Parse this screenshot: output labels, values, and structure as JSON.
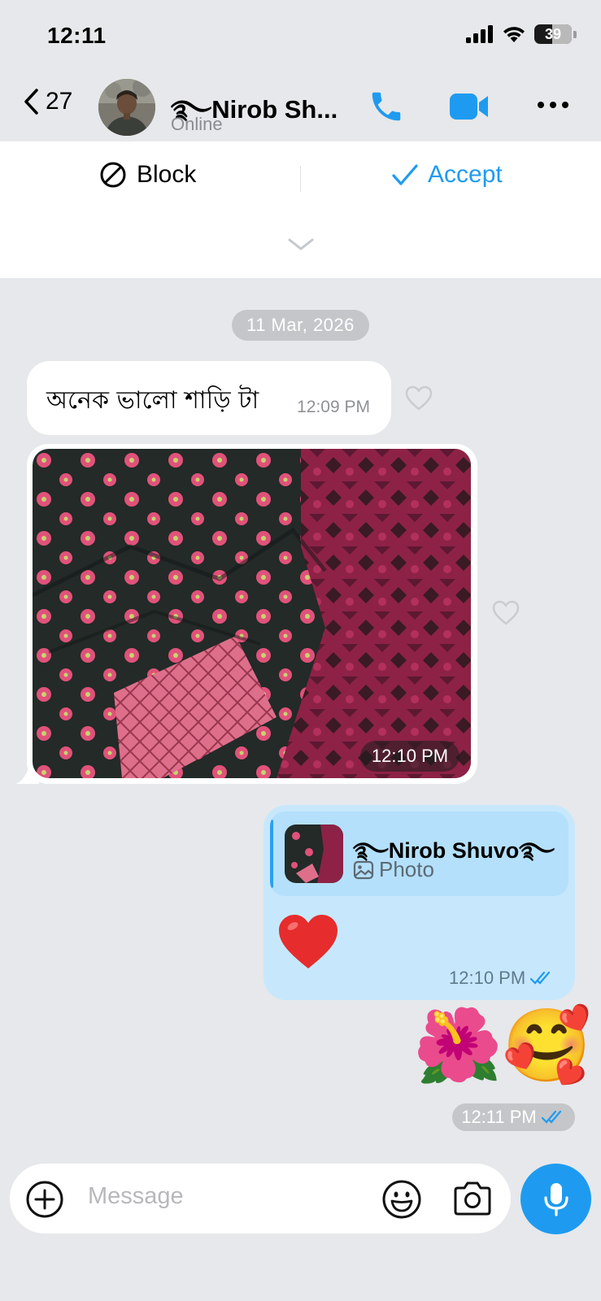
{
  "status": {
    "time": "12:11",
    "battery": "39"
  },
  "header": {
    "back_count": "27",
    "contact_name": "࿐Nirob Sh...",
    "contact_status": "Online"
  },
  "request": {
    "block_label": "Block",
    "accept_label": "Accept"
  },
  "date_separator": "11 Mar, 2026",
  "messages": [
    {
      "text": "অনেক ভালো শাড়ি টা",
      "time": "12:09 PM"
    },
    {
      "type": "photo",
      "time": "12:10 PM"
    },
    {
      "reply_to_name": "࿐Nirob Shuvo࿐",
      "reply_to_type": "Photo",
      "emoji": "❤️",
      "time": "12:10 PM"
    },
    {
      "emoji": "🌺🥰",
      "time": "12:11 PM"
    }
  ],
  "composer": {
    "placeholder": "Message"
  },
  "colors": {
    "accent": "#1e9bf0",
    "outgoing_bubble": "#c7e8fc",
    "background": "#e6e8eb"
  }
}
